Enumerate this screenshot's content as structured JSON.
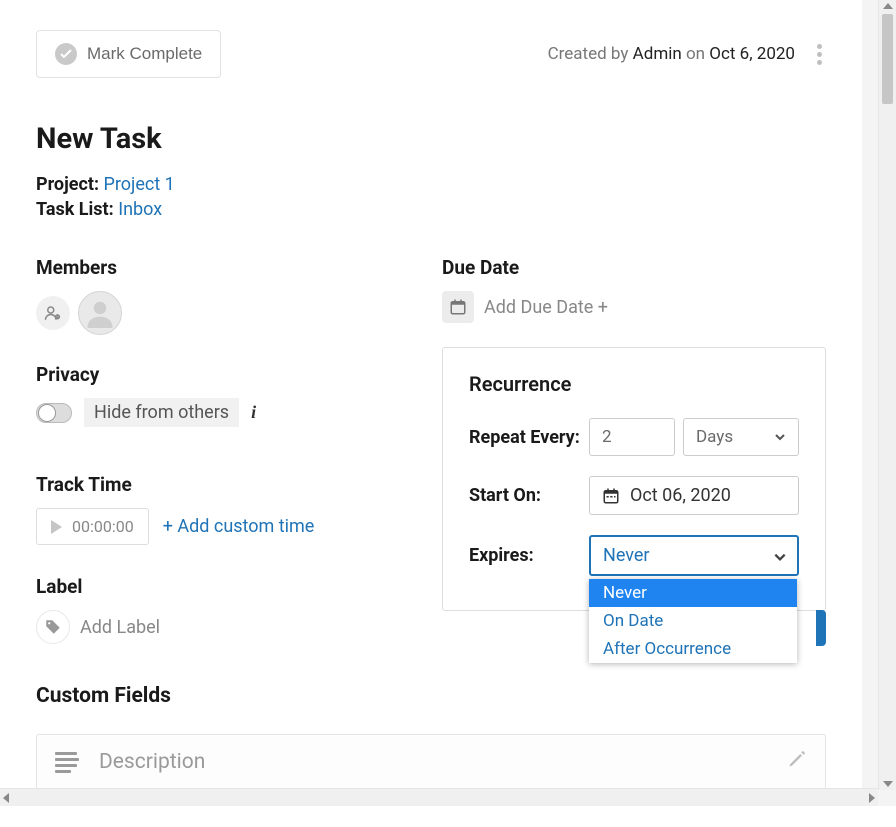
{
  "header": {
    "mark_complete": "Mark Complete",
    "created_by_prefix": "Created by",
    "created_by_name": "Admin",
    "created_on_word": "on",
    "created_date": "Oct 6, 2020"
  },
  "title": "New Task",
  "project": {
    "label": "Project:",
    "value": "Project 1"
  },
  "task_list": {
    "label": "Task List:",
    "value": "Inbox"
  },
  "members": {
    "title": "Members"
  },
  "privacy": {
    "title": "Privacy",
    "hide_label": "Hide from others"
  },
  "track_time": {
    "title": "Track Time",
    "value": "00:00:00",
    "add_custom": "+ Add custom time"
  },
  "label_section": {
    "title": "Label",
    "placeholder": "Add Label"
  },
  "due_date": {
    "title": "Due Date",
    "placeholder": "Add Due Date +"
  },
  "recurrence": {
    "title": "Recurrence",
    "repeat_label": "Repeat Every:",
    "repeat_value": "2",
    "repeat_unit": "Days",
    "start_label": "Start On:",
    "start_value": "Oct 06, 2020",
    "expires_label": "Expires:",
    "expires_value": "Never",
    "expires_options": [
      "Never",
      "On Date",
      "After Occurrence"
    ]
  },
  "custom_fields": {
    "title": "Custom Fields"
  },
  "description": {
    "placeholder": "Description"
  }
}
